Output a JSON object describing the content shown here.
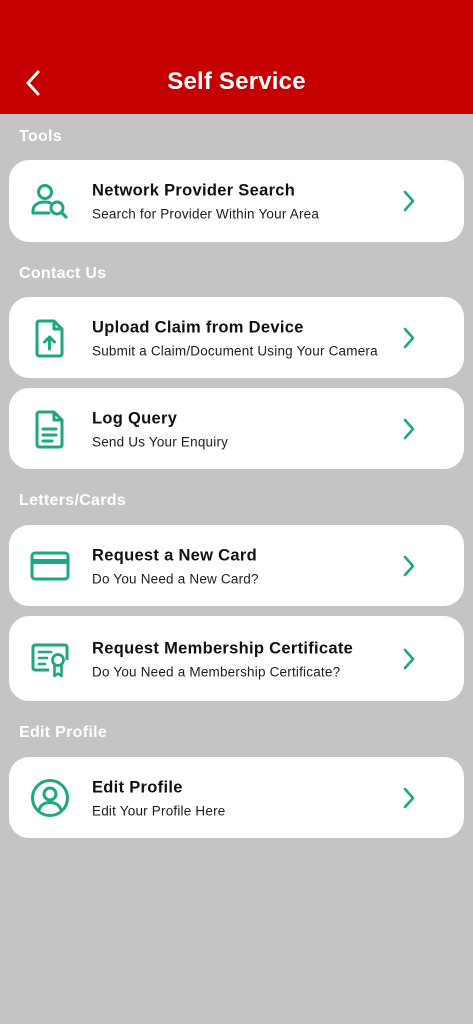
{
  "header": {
    "title": "Self Service",
    "back_icon": "chevron-left-icon"
  },
  "colors": {
    "header_bg": "#c60000",
    "page_bg": "#c4c4c6",
    "accent": "#1ea784",
    "card_bg": "#ffffff"
  },
  "sections": {
    "tools": "Tools",
    "contact": "Contact Us",
    "letters": "Letters/Cards",
    "profile": "Edit Profile"
  },
  "items": {
    "network": {
      "title": "Network Provider Search",
      "subtitle": "Search for Provider Within Your Area",
      "icon": "user-search-icon"
    },
    "upload": {
      "title": "Upload Claim from Device",
      "subtitle": "Submit a Claim/Document Using Your Camera",
      "icon": "file-upload-icon"
    },
    "query": {
      "title": "Log Query",
      "subtitle": "Send Us Your Enquiry",
      "icon": "document-icon"
    },
    "card": {
      "title": "Request a New Card",
      "subtitle": "Do You Need a New Card?",
      "icon": "credit-card-icon"
    },
    "certificate": {
      "title": "Request Membership Certificate",
      "subtitle": "Do You Need a Membership Certificate?",
      "icon": "certificate-icon"
    },
    "profile": {
      "title": "Edit Profile",
      "subtitle": "Edit Your Profile Here",
      "icon": "user-circle-icon"
    }
  }
}
